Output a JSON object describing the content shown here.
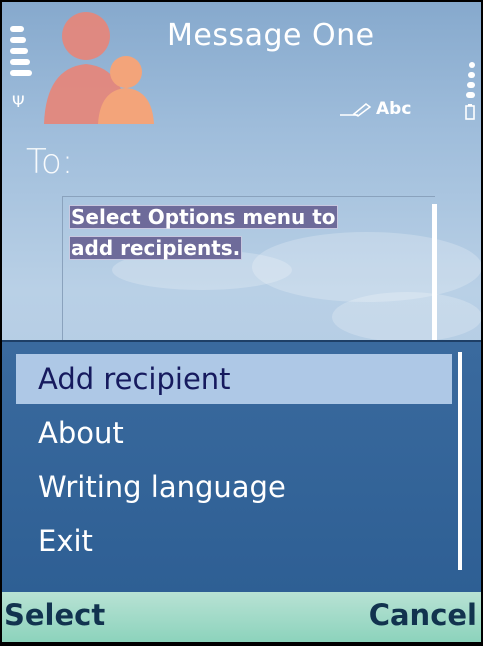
{
  "header": {
    "title": "Message One",
    "input_mode": "Abc",
    "icons": [
      "signal-strength-icon",
      "antenna-icon",
      "contacts-icon",
      "pen-input-icon",
      "battery-icon"
    ]
  },
  "editor": {
    "to_label": "To:",
    "hint_line1": "Select Options menu to",
    "hint_line2": "add recipients."
  },
  "menu": {
    "items": [
      {
        "label": "Add recipient",
        "selected": true
      },
      {
        "label": "About",
        "selected": false
      },
      {
        "label": "Writing language",
        "selected": false
      },
      {
        "label": "Exit",
        "selected": false
      }
    ]
  },
  "softkeys": {
    "left": "Select",
    "right": "Cancel"
  },
  "colors": {
    "menu_background": "#2e5f94",
    "menu_highlight": "#aec8e6",
    "softkey_bar": "#8cd3bc",
    "hint_highlight": "#6e6b9a"
  }
}
